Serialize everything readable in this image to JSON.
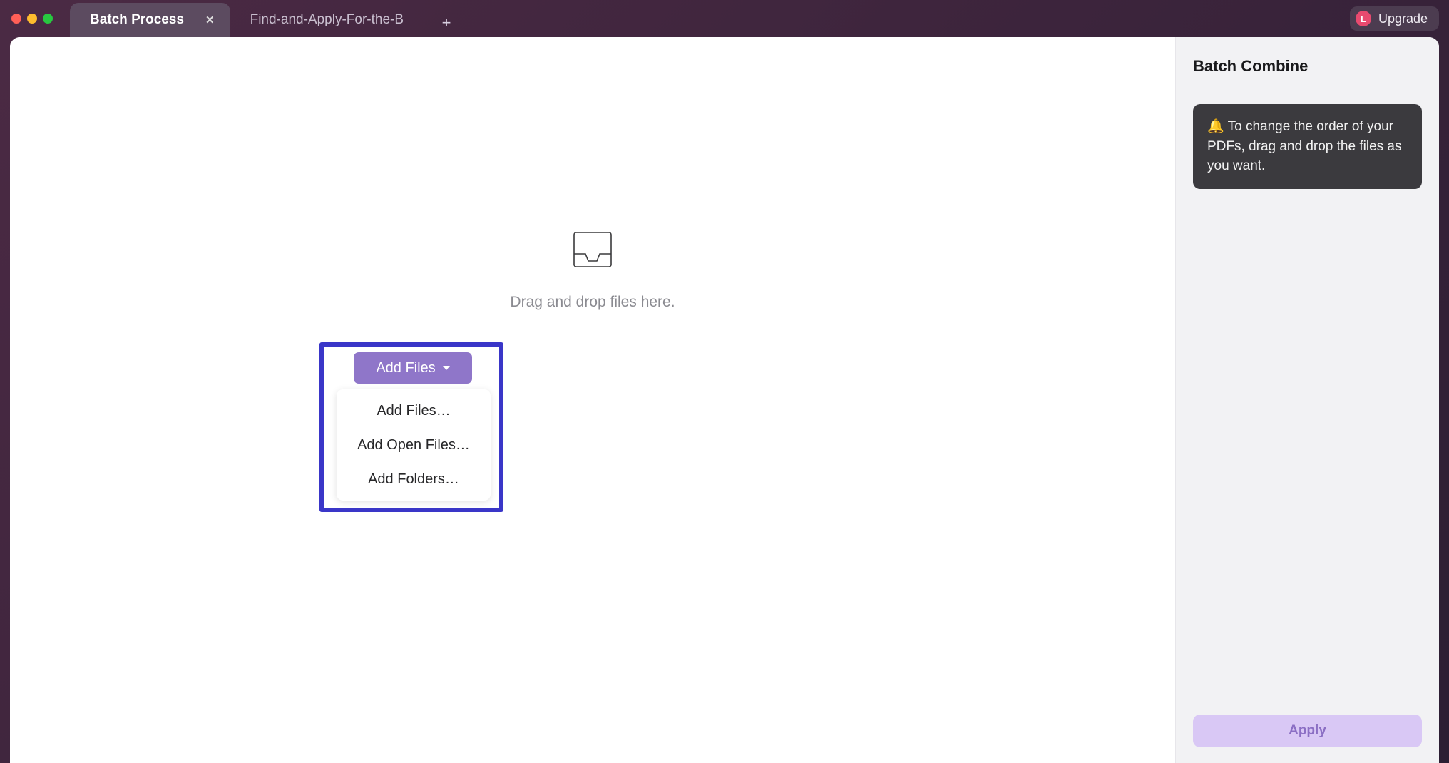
{
  "titlebar": {
    "tabs": [
      {
        "label": "Batch Process",
        "active": true
      },
      {
        "label": "Find-and-Apply-For-the-B",
        "active": false
      }
    ],
    "upgrade": {
      "avatar_letter": "L",
      "label": "Upgrade"
    }
  },
  "dropzone": {
    "hint": "Drag and drop files here.",
    "button_label": "Add Files",
    "menu": [
      "Add Files…",
      "Add Open Files…",
      "Add Folders…"
    ]
  },
  "side": {
    "title": "Batch Combine",
    "tip_icon": "🔔",
    "tip_text": "To change the order of your PDFs, drag and drop the files as you want.",
    "apply_label": "Apply"
  }
}
